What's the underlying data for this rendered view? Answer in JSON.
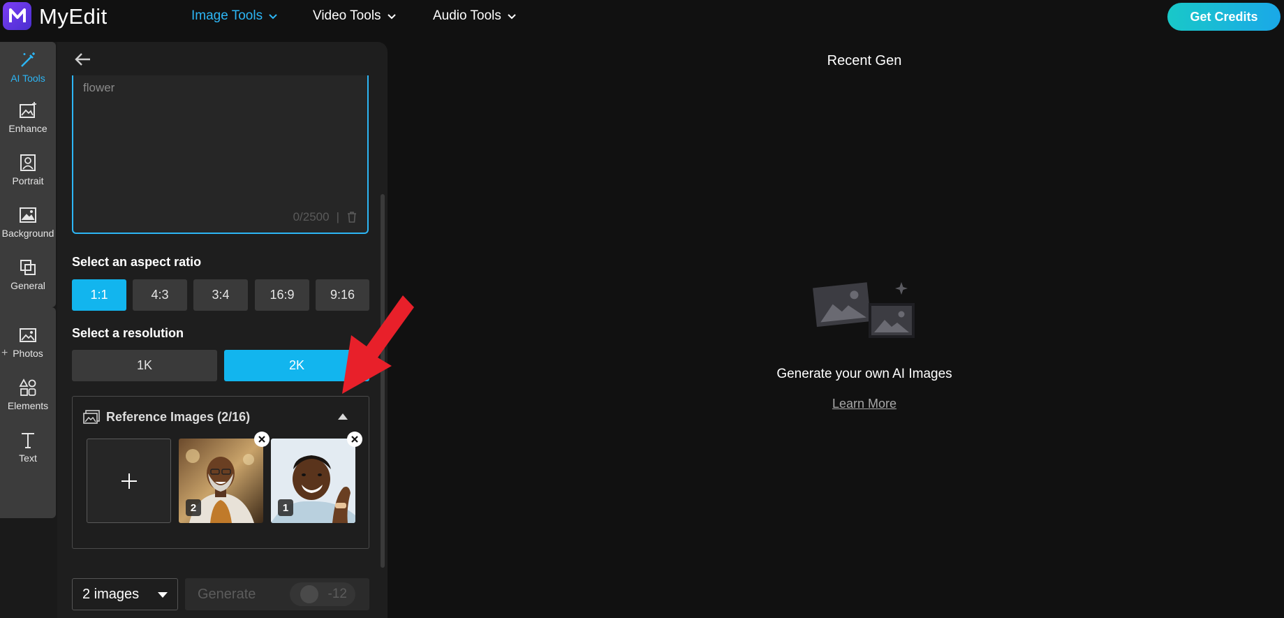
{
  "app": {
    "logo_text": "MyEdit",
    "get_credits_label": "Get Credits"
  },
  "nav": {
    "items": [
      {
        "label": "Image Tools",
        "active": true
      },
      {
        "label": "Video Tools",
        "active": false
      },
      {
        "label": "Audio Tools",
        "active": false
      }
    ]
  },
  "rail": {
    "items": [
      {
        "label": "AI Tools",
        "icon": "magic-wand-icon",
        "active": true
      },
      {
        "label": "Enhance",
        "icon": "enhance-icon"
      },
      {
        "label": "Portrait",
        "icon": "portrait-icon"
      },
      {
        "label": "Background",
        "icon": "background-icon"
      },
      {
        "label": "General",
        "icon": "general-icon"
      },
      {
        "label": "Photos",
        "icon": "photos-icon"
      },
      {
        "label": "Elements",
        "icon": "elements-icon"
      },
      {
        "label": "Text",
        "icon": "text-icon"
      }
    ],
    "plus_label": "+"
  },
  "panel": {
    "prompt": {
      "value": "flower",
      "counter": "0/2500",
      "separator": "|"
    },
    "aspect_ratio": {
      "label": "Select an aspect ratio",
      "options": [
        "1:1",
        "4:3",
        "3:4",
        "16:9",
        "9:16"
      ],
      "selected": "1:1"
    },
    "resolution": {
      "label": "Select a resolution",
      "options": [
        "1K",
        "2K"
      ],
      "selected": "2K"
    },
    "reference": {
      "title": "Reference Images (2/16)",
      "thumbs": [
        {
          "number": "2"
        },
        {
          "number": "1"
        }
      ]
    },
    "image_count": "2 images",
    "generate": {
      "label": "Generate",
      "cost": "-12"
    }
  },
  "main": {
    "title": "Recent Gen",
    "empty_message": "Generate your own AI Images",
    "learn_more": "Learn More"
  },
  "colors": {
    "accent": "#12b5ee",
    "annotation_arrow": "#e8202a",
    "background": "#111111"
  }
}
